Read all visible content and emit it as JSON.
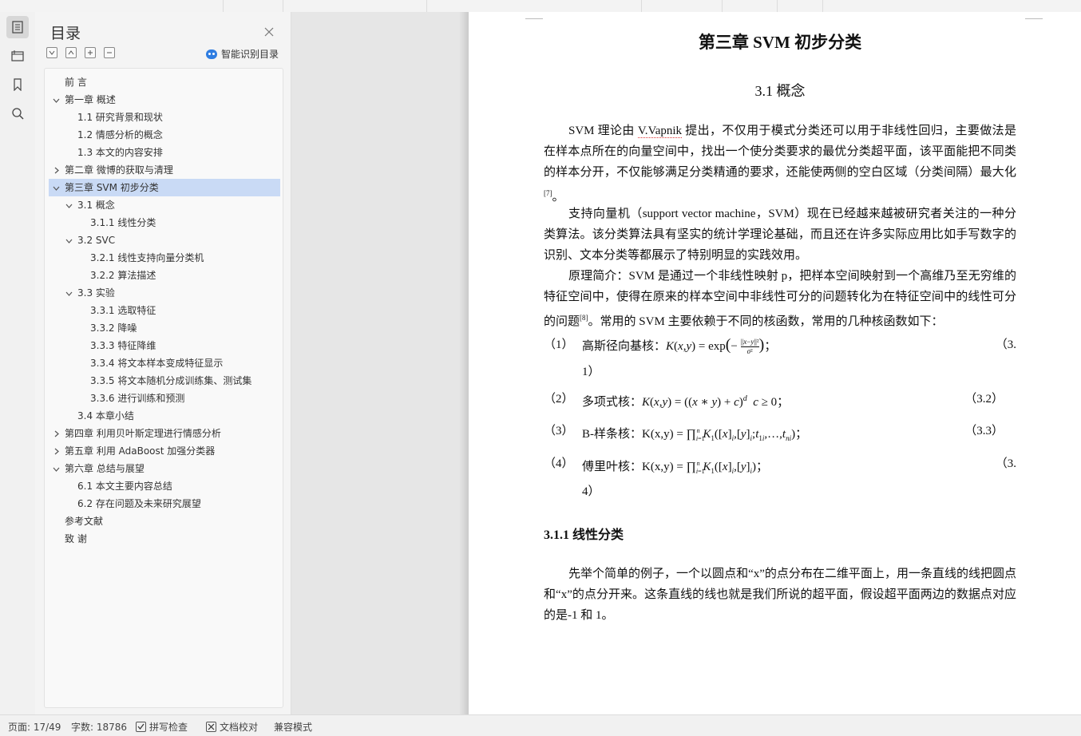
{
  "sidebar": {
    "icons": [
      "outline-icon",
      "navigation-icon",
      "bookmark-icon",
      "search-icon"
    ]
  },
  "toc": {
    "title": "目录",
    "smart_label": "智能识别目录",
    "items": [
      {
        "label": "前    言",
        "level": 0,
        "chevron": "none"
      },
      {
        "label": "第一章  概述",
        "level": 0,
        "chevron": "down"
      },
      {
        "label": "1.1  研究背景和现状",
        "level": 1,
        "chevron": "none"
      },
      {
        "label": "1.2  情感分析的概念",
        "level": 1,
        "chevron": "none"
      },
      {
        "label": "1.3  本文的内容安排",
        "level": 1,
        "chevron": "none"
      },
      {
        "label": "第二章  微博的获取与清理",
        "level": 0,
        "chevron": "right"
      },
      {
        "label": "第三章  SVM 初步分类",
        "level": 0,
        "chevron": "down",
        "selected": true
      },
      {
        "label": "3.1  概念",
        "level": 1,
        "chevron": "down"
      },
      {
        "label": "3.1.1  线性分类",
        "level": 2,
        "chevron": "none"
      },
      {
        "label": "3.2  SVC",
        "level": 1,
        "chevron": "down"
      },
      {
        "label": "3.2.1  线性支持向量分类机",
        "level": 2,
        "chevron": "none"
      },
      {
        "label": "3.2.2  算法描述",
        "level": 2,
        "chevron": "none"
      },
      {
        "label": "3.3  实验",
        "level": 1,
        "chevron": "down"
      },
      {
        "label": "3.3.1  选取特征",
        "level": 2,
        "chevron": "none"
      },
      {
        "label": "3.3.2  降噪",
        "level": 2,
        "chevron": "none"
      },
      {
        "label": "3.3.3  特征降维",
        "level": 2,
        "chevron": "none"
      },
      {
        "label": "3.3.4  将文本样本变成特征显示",
        "level": 2,
        "chevron": "none"
      },
      {
        "label": "3.3.5  将文本随机分成训练集、测试集",
        "level": 2,
        "chevron": "none"
      },
      {
        "label": "3.3.6  进行训练和预测",
        "level": 2,
        "chevron": "none"
      },
      {
        "label": "3.4  本章小结",
        "level": 1,
        "chevron": "none"
      },
      {
        "label": "第四章  利用贝叶斯定理进行情感分析",
        "level": 0,
        "chevron": "right"
      },
      {
        "label": "第五章  利用 AdaBoost 加强分类器",
        "level": 0,
        "chevron": "right"
      },
      {
        "label": "第六章  总结与展望",
        "level": 0,
        "chevron": "down"
      },
      {
        "label": "6.1  本文主要内容总结",
        "level": 1,
        "chevron": "none"
      },
      {
        "label": "6.2  存在问题及未来研究展望",
        "level": 1,
        "chevron": "none"
      },
      {
        "label": "参考文献",
        "level": 0,
        "chevron": "none"
      },
      {
        "label": "致    谢",
        "level": 0,
        "chevron": "none"
      }
    ]
  },
  "doc": {
    "chapter_title": "第三章  SVM 初步分类",
    "section_title": "3.1  概念",
    "p1_a": "SVM 理论由 ",
    "p1_name": "V.Vapnik",
    "p1_b": " 提出，不仅用于模式分类还可以用于非线性回归，主要做法是在样本点所在的向量空间中，找出一个使分类要求的最优分类超平面，该平面能把不同类的样本分开，不仅能够满足分类精通的要求，还能使两侧的空白区域（分类间隔）最大化",
    "p1_ref": "[7]",
    "p1_c": "。",
    "p2": "支持向量机（support  vector  machine，SVM）现在已经越来越被研究者关注的一种分类算法。该分类算法具有坚实的统计学理论基础，而且还在许多实际应用比如手写数字的识别、文本分类等都展示了特别明显的实践效用。",
    "p3_a": "原理简介：SVM 是通过一个非线性映射 p，把样本空间映射到一个高维乃至无穷维的特征空间中，使得在原来的样本空间中非线性可分的问题转化为在特征空间中的线性可分的问题",
    "p3_ref": "[8]",
    "p3_b": "。常用的 SVM 主要依赖于不同的核函数，常用的几种核函数如下：",
    "eq1_num": "（1）",
    "eq1_label": "高斯径向基核：",
    "eq1_tag": "（3.",
    "eq1_tag2": "1）",
    "eq2_num": "（2）",
    "eq2_label": "多项式核：",
    "eq2_tag": "（3.2）",
    "eq3_num": "（3）",
    "eq3_label": "B-样条核：",
    "eq3_tag": "（3.3）",
    "eq4_num": "（4）",
    "eq4_label": "傅里叶核：",
    "eq4_tag": "（3.",
    "eq4_tag2": "4）",
    "subsection_title": "3.1.1  线性分类",
    "p4": "先举个简单的例子，一个以圆点和“x”的点分布在二维平面上，用一条直线的线把圆点和“x”的点分开来。这条直线的线也就是我们所说的超平面，假设超平面两边的数据点对应的是-1 和 1。"
  },
  "status": {
    "page": "页面: 17/49",
    "words": "字数: 18786",
    "spell": "拼写检查",
    "proof": "文档校对",
    "compat": "兼容模式"
  }
}
